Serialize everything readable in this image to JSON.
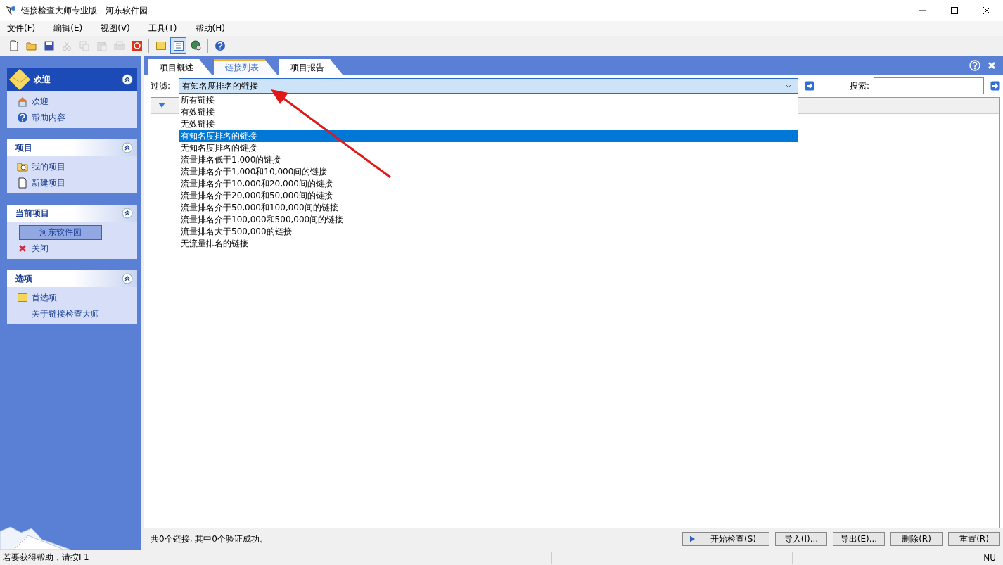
{
  "window": {
    "title": "链接检查大师专业版 - 河东软件园"
  },
  "menu": [
    "文件(F)",
    "编辑(E)",
    "视图(V)",
    "工具(T)",
    "帮助(H)"
  ],
  "toolbar": [
    {
      "disabled": false,
      "selected": false
    },
    {
      "disabled": false,
      "selected": false
    },
    {
      "disabled": false,
      "selected": false
    },
    {
      "disabled": true,
      "selected": false
    },
    {
      "disabled": true,
      "selected": false
    },
    {
      "disabled": true,
      "selected": false
    },
    {
      "disabled": true,
      "selected": false
    },
    {
      "disabled": false,
      "selected": false
    },
    {
      "disabled": false,
      "selected": false
    },
    {
      "disabled": false,
      "selected": true
    },
    {
      "disabled": false,
      "selected": false
    },
    {
      "disabled": false,
      "selected": false
    }
  ],
  "sidebar": [
    {
      "title": "欢迎",
      "kind": "primary",
      "expanded": true,
      "items": [
        {
          "label": "欢迎",
          "selected": false
        },
        {
          "label": "帮助内容",
          "selected": false
        }
      ]
    },
    {
      "title": "项目",
      "kind": "normal",
      "expanded": true,
      "items": [
        {
          "label": "我的项目",
          "selected": false
        },
        {
          "label": "新建项目",
          "selected": false
        }
      ]
    },
    {
      "title": "当前项目",
      "kind": "normal",
      "expanded": true,
      "items": [
        {
          "label": "河东软件园",
          "selected": true
        },
        {
          "label": "关闭",
          "selected": false
        }
      ]
    },
    {
      "title": "选项",
      "kind": "normal",
      "expanded": true,
      "items": [
        {
          "label": "首选项",
          "selected": false
        },
        {
          "label": "关于链接检查大师",
          "selected": false
        }
      ]
    }
  ],
  "tabs": [
    {
      "label": "项目概述",
      "selected": false
    },
    {
      "label": "链接列表",
      "selected": true
    },
    {
      "label": "项目报告",
      "selected": false
    }
  ],
  "filter": {
    "label": "过滤:",
    "value": "有知名度排名的链接",
    "expanded": true,
    "options": [
      {
        "label": "所有链接",
        "selected": false
      },
      {
        "label": "有效链接",
        "selected": false
      },
      {
        "label": "无效链接",
        "selected": false
      },
      {
        "label": "有知名度排名的链接",
        "selected": true
      },
      {
        "label": "无知名度排名的链接",
        "selected": false
      },
      {
        "label": "流量排名低于1,000的链接",
        "selected": false
      },
      {
        "label": "流量排名介于1,000和10,000间的链接",
        "selected": false
      },
      {
        "label": "流量排名介于10,000和20,000间的链接",
        "selected": false
      },
      {
        "label": "流量排名介于20,000和50,000间的链接",
        "selected": false
      },
      {
        "label": "流量排名介于50,000和100,000间的链接",
        "selected": false
      },
      {
        "label": "流量排名介于100,000和500,000间的链接",
        "selected": false
      },
      {
        "label": "流量排名大于500,000的链接",
        "selected": false
      },
      {
        "label": "无流量排名的链接",
        "selected": false
      }
    ]
  },
  "search": {
    "label": "搜索:"
  },
  "summary": "共0个链接, 其中0个验证成功。",
  "buttons": [
    "开始检查(S)",
    "导入(I)...",
    "导出(E)...",
    "删除(R)",
    "重置(R)"
  ],
  "status_bar": {
    "text": "若要获得帮助，请按F1",
    "indicator": "NU"
  }
}
